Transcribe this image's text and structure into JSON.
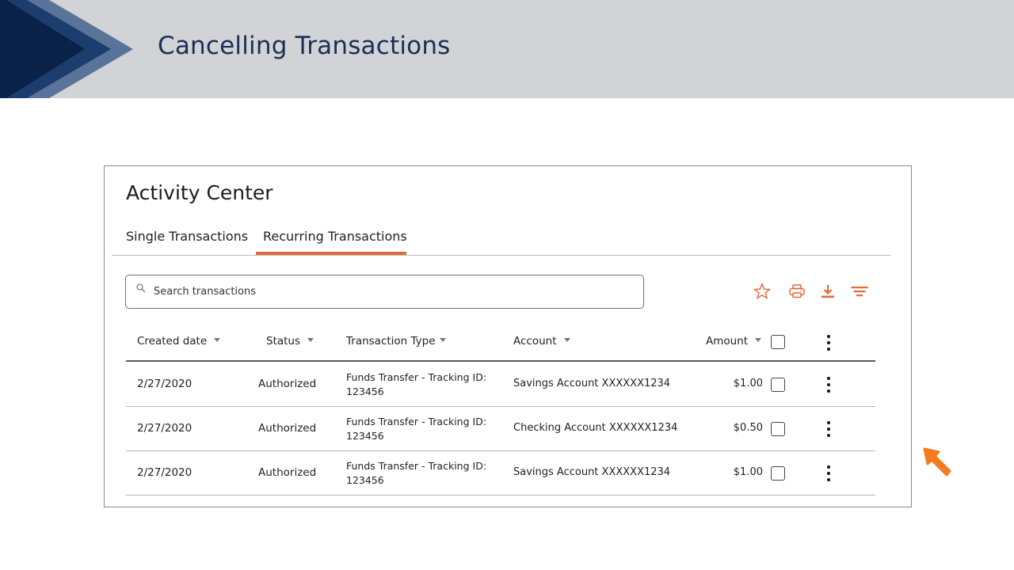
{
  "slide": {
    "title": "Cancelling Transactions",
    "colors": {
      "banner": "#d1d3d6",
      "chevron_dark": "#0b2248",
      "chevron_mid": "#1c3d6d",
      "chevron_light": "#5a7398",
      "title": "#1b2f55",
      "accent": "#e06a3b",
      "pointer": "#f47b20"
    }
  },
  "app": {
    "title": "Activity Center",
    "tabs": [
      {
        "label": "Single Transactions",
        "active": false
      },
      {
        "label": "Recurring Transactions",
        "active": true
      }
    ],
    "search": {
      "placeholder": "Search transactions",
      "value": ""
    },
    "toolbar": {
      "icons": [
        "star-icon",
        "printer-icon",
        "download-icon",
        "filter-icon"
      ]
    },
    "table": {
      "columns": [
        {
          "label": "Created date",
          "sortable": true
        },
        {
          "label": "Status",
          "sortable": true
        },
        {
          "label": "Transaction Type",
          "sortable": true
        },
        {
          "label": "Account",
          "sortable": true
        },
        {
          "label": "Amount",
          "sortable": true
        }
      ],
      "select_all_checked": false,
      "rows": [
        {
          "date": "2/27/2020",
          "status": "Authorized",
          "type_line1": "Funds Transfer -  Tracking ID:",
          "type_line2": "123456",
          "account": "Savings Account XXXXXX1234",
          "amount": "$1.00",
          "checked": false
        },
        {
          "date": "2/27/2020",
          "status": "Authorized",
          "type_line1": "Funds Transfer -  Tracking ID:",
          "type_line2": "123456",
          "account": "Checking Account XXXXXX1234",
          "amount": "$0.50",
          "checked": false
        },
        {
          "date": "2/27/2020",
          "status": "Authorized",
          "type_line1": "Funds Transfer -  Tracking ID:",
          "type_line2": "123456",
          "account": "Savings Account XXXXXX1234",
          "amount": "$1.00",
          "checked": false
        }
      ]
    }
  }
}
